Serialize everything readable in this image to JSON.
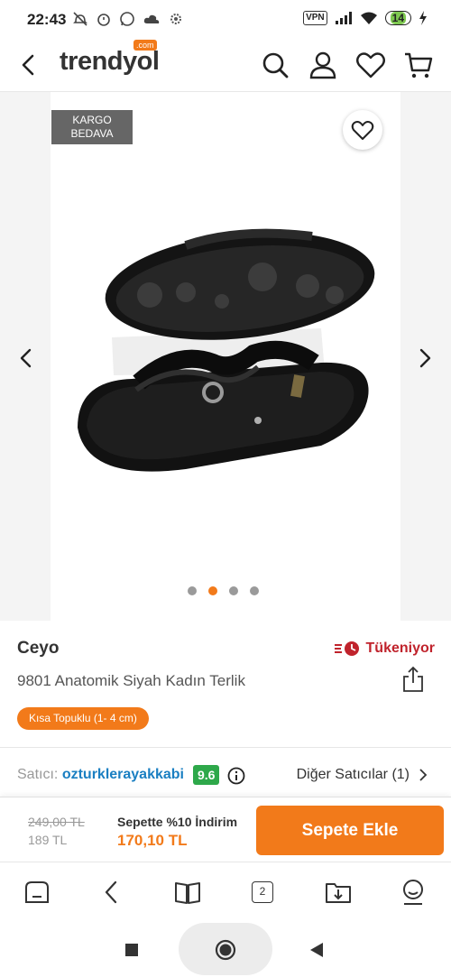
{
  "status_bar": {
    "time": "22:43",
    "vpn": "VPN",
    "battery": "14"
  },
  "header": {
    "logo": "trendyol",
    "logo_badge": ".com"
  },
  "gallery": {
    "badge_line1": "KARGO",
    "badge_line2": "BEDAVA",
    "image_count": 4,
    "active_index": 1
  },
  "product": {
    "brand": "Ceyo",
    "stock_label": "Tükeniyor",
    "title": "9801 Anatomik Siyah Kadın Terlik",
    "chip": "Kısa Topuklu (1- 4 cm)"
  },
  "seller": {
    "label": "Satıcı:",
    "name": "ozturklerayakkabi",
    "score": "9.6",
    "other_sellers": "Diğer Satıcılar (1)"
  },
  "buy_bar": {
    "old_price": "249,00 TL",
    "price": "189 TL",
    "campaign_label": "Sepette %10 İndirim",
    "campaign_price": "170,10 TL",
    "add_to_cart": "Sepete Ekle"
  },
  "browser_toolbar": {
    "tab_count": "2"
  },
  "colors": {
    "brand_orange": "#f27a1a",
    "stock_red": "#c0232c",
    "score_green": "#2ea84a",
    "seller_blue": "#1a7fc2"
  }
}
